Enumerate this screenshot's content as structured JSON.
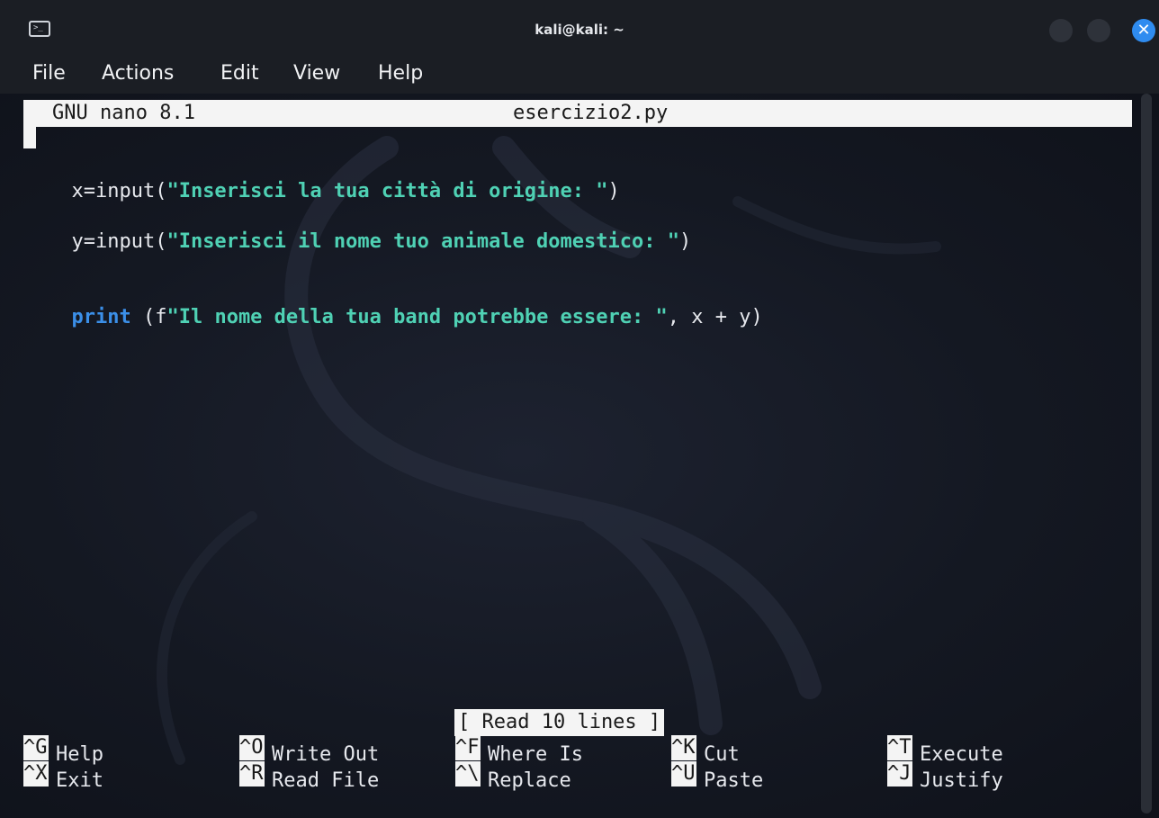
{
  "window": {
    "title": "kali@kali: ~"
  },
  "menu": [
    "File",
    "Actions",
    "Edit",
    "View",
    "Help"
  ],
  "nano": {
    "version": "GNU nano 8.1",
    "filename": "esercizio2.py",
    "status": "[ Read 10 lines ]"
  },
  "code": [
    {
      "pre": "x=input(",
      "str": "\"Inserisci la tua città di origine: \"",
      "post": ")"
    },
    {
      "pre": "y=input(",
      "str": "\"Inserisci il nome tuo animale domestico: \"",
      "post": ")"
    },
    {
      "kw": "print",
      "pre": " (f",
      "str": "\"Il nome della tua band potrebbe essere: \"",
      "post": ", x + y)"
    }
  ],
  "shortcuts": {
    "row1": [
      {
        "key": "^G",
        "label": "Help"
      },
      {
        "key": "^O",
        "label": "Write Out"
      },
      {
        "key": "^F",
        "label": "Where Is"
      },
      {
        "key": "^K",
        "label": "Cut"
      },
      {
        "key": "^T",
        "label": "Execute"
      }
    ],
    "row2": [
      {
        "key": "^X",
        "label": "Exit"
      },
      {
        "key": "^R",
        "label": "Read File"
      },
      {
        "key": "^\\",
        "label": "Replace"
      },
      {
        "key": "^U",
        "label": "Paste"
      },
      {
        "key": "^J",
        "label": "Justify"
      }
    ]
  },
  "colors": {
    "keyword": "#3b8fe8",
    "string": "#4fd1b4",
    "close_button": "#2f8cf0"
  }
}
